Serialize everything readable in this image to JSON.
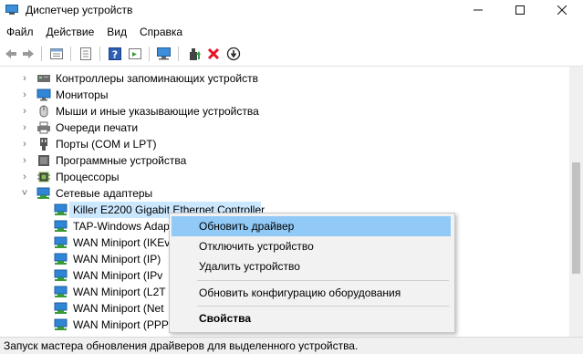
{
  "window": {
    "title": "Диспетчер устройств"
  },
  "menu": {
    "items": [
      "Файл",
      "Действие",
      "Вид",
      "Справка"
    ]
  },
  "toolbar": {
    "buttons": [
      "back-icon",
      "forward-icon",
      "properties-icon",
      "view-icon",
      "help-icon",
      "show-hidden-icon",
      "scan-icon",
      "update-driver-icon",
      "uninstall-icon",
      "disable-icon"
    ]
  },
  "tree": {
    "categories": [
      {
        "label": "Контроллеры запоминающих устройств",
        "icon": "storage-controller-icon",
        "expanded": false
      },
      {
        "label": "Мониторы",
        "icon": "monitor-icon",
        "expanded": false
      },
      {
        "label": "Мыши и иные указывающие устройства",
        "icon": "mouse-icon",
        "expanded": false
      },
      {
        "label": "Очереди печати",
        "icon": "printer-icon",
        "expanded": false
      },
      {
        "label": "Порты (COM и LPT)",
        "icon": "port-icon",
        "expanded": false
      },
      {
        "label": "Программные устройства",
        "icon": "software-device-icon",
        "expanded": false
      },
      {
        "label": "Процессоры",
        "icon": "processor-icon",
        "expanded": false
      },
      {
        "label": "Сетевые адаптеры",
        "icon": "network-adapter-icon",
        "expanded": true
      }
    ],
    "adapters": [
      "Killer E2200 Gigabit Ethernet Controller",
      "TAP-Windows Adap",
      "WAN Miniport (IKEv",
      "WAN Miniport (IP)",
      "WAN Miniport (IPv",
      "WAN Miniport (L2T",
      "WAN Miniport (Net",
      "WAN Miniport (PPP"
    ]
  },
  "context_menu": {
    "items": [
      {
        "label": "Обновить драйвер",
        "highlighted": true
      },
      {
        "label": "Отключить устройство"
      },
      {
        "label": "Удалить устройство"
      },
      {
        "label": "Обновить конфигурацию оборудования"
      },
      {
        "label": "Свойства",
        "bold": true
      }
    ]
  },
  "status": {
    "text": "Запуск мастера обновления драйверов для выделенного устройства."
  },
  "colors": {
    "selection": "#cce8ff",
    "menu_highlight": "#91c9f7",
    "accent_blue": "#1f73c8",
    "red_x": "#e81123"
  }
}
